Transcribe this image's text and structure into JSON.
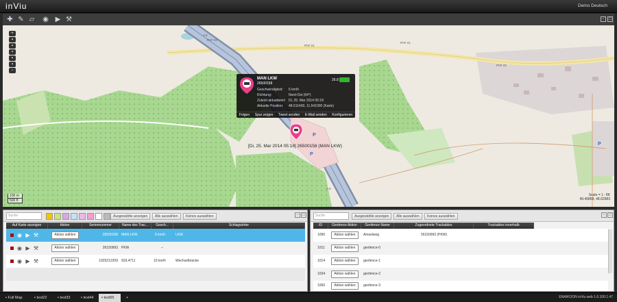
{
  "app": {
    "logo": "inViu",
    "user": "Demo Deutsch"
  },
  "popup": {
    "title": "MAN LKW",
    "serial": "26500158",
    "battery": "26.8",
    "speed_label": "Geschwindigkeit:",
    "speed": "6 km/h",
    "direction_label": "Richtung:",
    "direction": "Nord-Ost (64°)",
    "updated_label": "Zuletzt aktualisiert:",
    "updated": "Di, 25. Mar 2014 05:18",
    "position_label": "Aktuelle Position:",
    "position": "48.611400, 11.541000 (Karte)",
    "actions": [
      "Folgen",
      "Spur zeigen",
      "Tweet senden",
      "E-Mail senden",
      "Konfigurieren"
    ]
  },
  "map": {
    "label": "[Di, 25. Mar 2014 05:18] 26500158 (MAN LKW)",
    "scale_top": "100 m",
    "scale_bottom": "500 ft",
    "attribution1": "Scale = 1 : 8K",
    "attribution2": "49.40868, 48.62983",
    "roads": [
      "PAF 23",
      "PAF 21",
      "PAF 21",
      "A 9",
      "A 9",
      "PAF 23"
    ]
  },
  "left": {
    "search": "Suche",
    "buttons": [
      "Ausgewählte anzeigen",
      "Alle auswählen",
      "Keines auswählen"
    ],
    "swatches": [
      "#f4c400",
      "#c6e67c",
      "#d6a8e6",
      "#c8e0f8",
      "#e8b8e8",
      "#f0a0d0",
      "#ffffff",
      "#bbbbbb"
    ],
    "columns": [
      "Auf Karte anzeigen",
      "Aktion",
      "Seriennummer",
      "Name des Trac...",
      "Gesch...",
      "Schlagwörter"
    ],
    "rows": [
      {
        "action": "Aktion wählen",
        "serial": "26500158",
        "name": "MAN LKW",
        "speed": "6 km/h",
        "tags": "LKW"
      },
      {
        "action": "Aktion wählen",
        "serial": "26150993",
        "name": "PKW",
        "speed": "--",
        "tags": ""
      },
      {
        "action": "Aktion wählen",
        "serial": "1925212209",
        "name": "SDL4711",
        "speed": "10 km/h",
        "tags": "Wechselbrücke"
      }
    ]
  },
  "right": {
    "search": "Suche",
    "buttons": [
      "Ausgewählte anzeigen",
      "Alle auswählen",
      "Keines auswählen"
    ],
    "columns": [
      "ID",
      "Geofence Aktion",
      "Geofence Name",
      "Zugeordnete Trackables",
      "Trackables innerhalb"
    ],
    "rows": [
      {
        "id": "1090",
        "action": "Aktion wählen",
        "name": "Amselweg",
        "assigned": "26150993 (PKW)",
        "inside": ""
      },
      {
        "id": "1011",
        "action": "Aktion wählen",
        "name": "geofence-0",
        "assigned": "",
        "inside": ""
      },
      {
        "id": "1014",
        "action": "Aktion wählen",
        "name": "geofence-1",
        "assigned": "",
        "inside": ""
      },
      {
        "id": "1034",
        "action": "Aktion wählen",
        "name": "geofence-2",
        "assigned": "",
        "inside": ""
      },
      {
        "id": "1066",
        "action": "Aktion wählen",
        "name": "geofence-3",
        "assigned": "",
        "inside": ""
      }
    ]
  },
  "tabs": [
    "Full Map",
    "test22",
    "test33",
    "test44",
    "test55",
    "+"
  ],
  "version": "ENAIKOON inViu web 1.6.100.1.47"
}
